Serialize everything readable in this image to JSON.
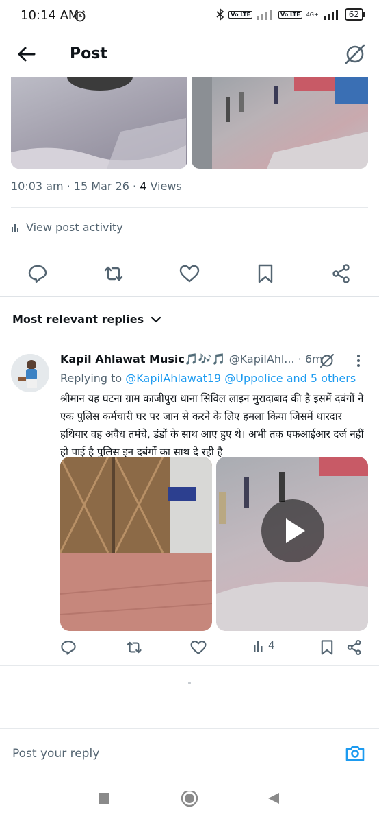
{
  "status": {
    "time": "10:14 AM",
    "battery": "62",
    "lte1": "Vo LTE",
    "lte2": "Vo LTE",
    "net": "4G+"
  },
  "header": {
    "title": "Post",
    "back_icon": "arrow-left-icon",
    "grok_icon": "grok-icon"
  },
  "post": {
    "time": "10:03 am · 15 Mar 26 · ",
    "views": "4",
    "views_label": " Views",
    "view_activity": "View post activity"
  },
  "sort": {
    "label": "Most relevant replies"
  },
  "reply": {
    "name": "Kapil Ahlawat Music🎵🎶🎵",
    "handle": "@KapilAhl...",
    "age": "· 6m",
    "replying_prefix": "Replying to ",
    "replying_to": "@KapilAhlawat19 @Uppolice and 5 others",
    "text": "श्रीमान यह घटना ग्राम काजीपुरा थाना सिविल लाइन मुरादाबाद की है इसमें दबंगों ने एक पुलिस कर्मचारी घर पर जान से करने के लिए हमला किया जिसमें धारदार हथियार वह अवैध तमंचे, डंडों के साथ आए हुए थे। अभी तक एफआईआर दर्ज नहीं हो पाई है पुलिस इन दबंगों का साथ दे रही है",
    "views": "4"
  },
  "compose": {
    "placeholder": "Post your reply"
  },
  "colors": {
    "accent": "#1d9bf0",
    "secondary_text": "#536471"
  }
}
